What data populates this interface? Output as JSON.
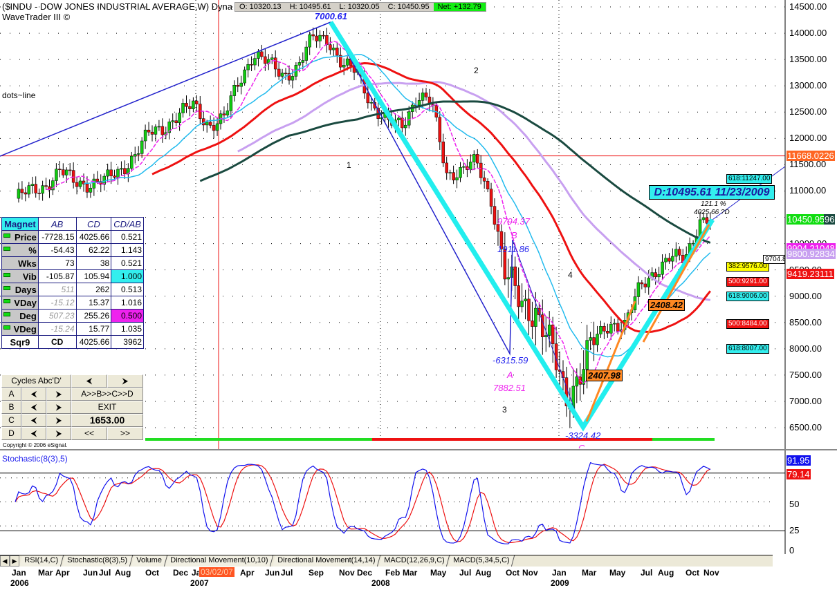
{
  "header": {
    "title": "($INDU - DOW JONES INDUSTRIAL AVERAGE,W) Dyna",
    "subtitle": "WaveTrader III ©",
    "ohlc": {
      "open": "O: 10320.13",
      "high": "H: 10495.61",
      "low": "L: 10320.05",
      "close": "C: 10450.95",
      "net": "Net: +132.79"
    }
  },
  "annotations": {
    "peak": "7000.61",
    "dots_line": "dots~line",
    "wave1": "1",
    "wave2": "2",
    "wave3": "3",
    "wave4": "4",
    "b_price": "9794.37",
    "b_label": "B",
    "bc": "1911.86",
    "ab": "-6315.59",
    "a_label": "A",
    "a_price": "7882.51",
    "cd": "-3324.42",
    "c_label": "C",
    "box_c": "2407.98",
    "box_d": "2408.42",
    "d_box": "D:10495.61 11/23/2009",
    "pct": "121.1 %",
    "d_proj": "4025.66 ?D"
  },
  "fib_levels": [
    {
      "label": "618:11247.00",
      "price": 11247,
      "color": "#33eeee"
    },
    {
      "label": "382:9576.00",
      "price": 9576,
      "color": "#ffff00"
    },
    {
      "label": "500:9291.00",
      "price": 9291,
      "color": "#ee1111"
    },
    {
      "label": "618:9006.00",
      "price": 9006,
      "color": "#33eeee"
    },
    {
      "label": "500:8484.00",
      "price": 8484,
      "color": "#ee1111"
    },
    {
      "label": "618:8007.00",
      "price": 8007,
      "color": "#33eeee"
    }
  ],
  "price_axis": {
    "ticks": [
      "14500.00",
      "14000.00",
      "13500.00",
      "13000.00",
      "12500.00",
      "12000.00",
      "11500.00",
      "11000.00",
      "10500.00",
      "10000.00",
      "9500.00",
      "9000.00",
      "8500.00",
      "8000.00",
      "7500.00",
      "7000.00",
      "6500.00"
    ],
    "tags": [
      {
        "label": "11668.0226",
        "price": 11668.0226,
        "color": "#ff6622"
      },
      {
        "label": "9904.21048",
        "price": 9904.21,
        "color": "#ee22ee"
      },
      {
        "label": "9800.92834",
        "price": 9800.93,
        "color": "#c8a0f0"
      },
      {
        "label": "9419.23111",
        "price": 9419.23,
        "color": "#ee1111"
      },
      {
        "label": "10450.95",
        "price": 10450.95,
        "color": "#11dd11"
      }
    ],
    "extra_tag": "96",
    "side_box": "9704.8"
  },
  "magnet": {
    "headers": [
      "Magnet",
      "AB",
      "CD",
      "CD/AB"
    ],
    "rows": [
      [
        "Price",
        "-7728.15",
        "4025.66",
        "0.521"
      ],
      [
        "%",
        "-54.43",
        "62.22",
        "1.143"
      ],
      [
        "Wks",
        "73",
        "38",
        "0.521"
      ],
      [
        "Vib",
        "-105.87",
        "105.94",
        "1.000"
      ],
      [
        "Days",
        "511",
        "262",
        "0.513"
      ],
      [
        "VDay",
        "-15.12",
        "15.37",
        "1.016"
      ],
      [
        "Deg",
        "507.23",
        "255.26",
        "0.500"
      ],
      [
        "VDeg",
        "-15.24",
        "15.77",
        "1.035"
      ],
      [
        "Sqr9",
        "CD",
        "4025.66",
        "3962"
      ]
    ]
  },
  "controls": {
    "cycles": "Cycles Abc'D'",
    "prev": "⮜",
    "next": "⮞",
    "a": "A",
    "b": "B",
    "c": "C",
    "d": "D",
    "abcd": "A>>B>>C>>D",
    "exit": "EXIT",
    "value": "1653.00",
    "rew": "<<",
    "fwd": ">>"
  },
  "copyright": "Copyright © 2006 eSignal.",
  "stochastic": {
    "title": "Stochastic(8(3),5)",
    "k_value": "91.95",
    "d_value": "79.14",
    "ticks": [
      "75",
      "50",
      "25",
      "0"
    ]
  },
  "tabs": [
    "RSI(14,C)",
    "Stochastic(8(3),5)",
    "Volume",
    "Directional Movement(10,10)",
    "Directional Movement(14,14)",
    "MACD(12,26,9,C)",
    "MACD(5,34,5,C)"
  ],
  "time_axis": {
    "months": [
      [
        "Jan",
        17
      ],
      [
        "Mar",
        55
      ],
      [
        "Apr",
        80
      ],
      [
        "Jun",
        120
      ],
      [
        "Jul",
        143
      ],
      [
        "Aug",
        166
      ],
      [
        "Oct",
        210
      ],
      [
        "Dec",
        250
      ],
      [
        "Ja",
        277
      ],
      [
        "Apr",
        347
      ],
      [
        "Jun",
        383
      ],
      [
        "Jul",
        406
      ],
      [
        "Sep",
        446
      ],
      [
        "Nov",
        490
      ],
      [
        "Dec",
        516
      ],
      [
        "Feb",
        557
      ],
      [
        "Mar",
        582
      ],
      [
        "May",
        622
      ],
      [
        "Jul",
        664
      ],
      [
        "Aug",
        687
      ],
      [
        "Oct",
        731
      ],
      [
        "Nov",
        755
      ],
      [
        "Jan",
        798
      ],
      [
        "Mar",
        841
      ],
      [
        "May",
        881
      ],
      [
        "Jul",
        926
      ],
      [
        "Aug",
        951
      ],
      [
        "Oct",
        991
      ],
      [
        "Nov",
        1017
      ]
    ],
    "years": [
      "2006",
      "2007",
      "2008",
      "2009"
    ],
    "cursor_date": "03/02/07"
  },
  "chart_data": {
    "type": "candlestick",
    "title": "$INDU - DOW JONES INDUSTRIAL AVERAGE, Weekly",
    "ylim": [
      6500,
      14500
    ],
    "x_start": "Jan 2006",
    "x_end": "Nov 2009",
    "monthly_close": [
      10860,
      10990,
      11110,
      11370,
      11170,
      11150,
      11180,
      11380,
      11680,
      12080,
      12220,
      12460,
      12620,
      12270,
      12350,
      13060,
      13630,
      13410,
      13210,
      13360,
      13900,
      13930,
      13370,
      13260,
      12650,
      12270,
      12260,
      12820,
      12640,
      11350,
      11380,
      11540,
      10850,
      9330,
      8830,
      8780,
      8000,
      7060,
      7610,
      8170,
      8500,
      8450,
      9170,
      9500,
      9710,
      9710,
      10450
    ],
    "colors": {
      "up": "#11cc11",
      "down": "#ee1111",
      "ma_fast": "#ee22ee",
      "ma_cyan": "#22bbee",
      "ma_red": "#ee1111",
      "ma_lav": "#c8a0f0",
      "ma_long": "#1a4a40"
    }
  }
}
